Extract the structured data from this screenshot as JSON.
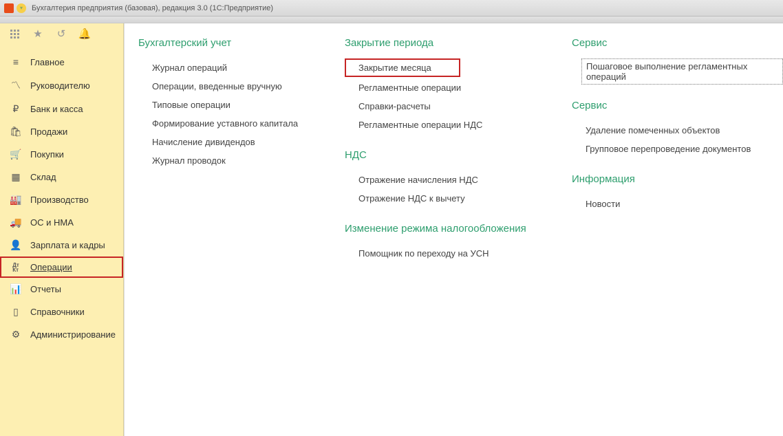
{
  "titlebar": {
    "title": "Бухгалтерия предприятия (базовая), редакция 3.0  (1С:Предприятие)"
  },
  "sidebar": {
    "items": [
      {
        "label": "Главное",
        "icon": "menu"
      },
      {
        "label": "Руководителю",
        "icon": "chart"
      },
      {
        "label": "Банк и касса",
        "icon": "ruble"
      },
      {
        "label": "Продажи",
        "icon": "bag"
      },
      {
        "label": "Покупки",
        "icon": "cart"
      },
      {
        "label": "Склад",
        "icon": "boxes"
      },
      {
        "label": "Производство",
        "icon": "factory"
      },
      {
        "label": "ОС и НМА",
        "icon": "truck"
      },
      {
        "label": "Зарплата и кадры",
        "icon": "person"
      },
      {
        "label": "Операции",
        "icon": "dtkt",
        "active": true
      },
      {
        "label": "Отчеты",
        "icon": "stats"
      },
      {
        "label": "Справочники",
        "icon": "book"
      },
      {
        "label": "Администрирование",
        "icon": "gear"
      }
    ]
  },
  "main": {
    "col1": {
      "heading": "Бухгалтерский учет",
      "links": [
        "Журнал операций",
        "Операции, введенные вручную",
        "Типовые операции",
        "Формирование уставного капитала",
        "Начисление дивидендов",
        "Журнал проводок"
      ]
    },
    "col2": {
      "sec1": {
        "heading": "Закрытие периода",
        "links": [
          "Закрытие месяца",
          "Регламентные операции",
          "Справки-расчеты",
          "Регламентные операции НДС"
        ]
      },
      "sec2": {
        "heading": "НДС",
        "links": [
          "Отражение начисления НДС",
          "Отражение НДС к вычету"
        ]
      },
      "sec3": {
        "heading": "Изменение режима налогообложения",
        "links": [
          "Помощник по переходу на УСН"
        ]
      }
    },
    "col3": {
      "sec1": {
        "heading": "Сервис",
        "links": [
          "Пошаговое выполнение регламентных операций"
        ]
      },
      "sec2": {
        "heading": "Сервис",
        "links": [
          "Удаление помеченных объектов",
          "Групповое перепроведение документов"
        ]
      },
      "sec3": {
        "heading": "Информация",
        "links": [
          "Новости"
        ]
      }
    }
  }
}
